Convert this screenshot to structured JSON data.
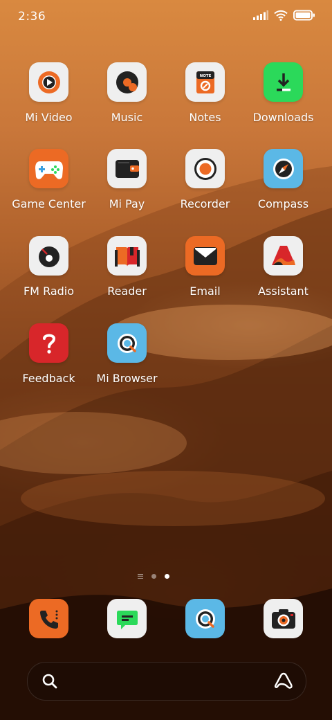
{
  "status_bar": {
    "time": "2:36",
    "icons": [
      "signal-icon",
      "wifi-icon",
      "battery-icon"
    ]
  },
  "apps": [
    {
      "label": "Mi Video",
      "icon": "mi-video-icon"
    },
    {
      "label": "Music",
      "icon": "music-icon"
    },
    {
      "label": "Notes",
      "icon": "notes-icon",
      "icon_text": "NOTE"
    },
    {
      "label": "Downloads",
      "icon": "downloads-icon"
    },
    {
      "label": "Game Center",
      "icon": "game-center-icon"
    },
    {
      "label": "Mi Pay",
      "icon": "mi-pay-icon"
    },
    {
      "label": "Recorder",
      "icon": "recorder-icon"
    },
    {
      "label": "Compass",
      "icon": "compass-icon"
    },
    {
      "label": "FM Radio",
      "icon": "fm-radio-icon"
    },
    {
      "label": "Reader",
      "icon": "reader-icon"
    },
    {
      "label": "Email",
      "icon": "email-icon"
    },
    {
      "label": "Assistant",
      "icon": "assistant-icon"
    },
    {
      "label": "Feedback",
      "icon": "feedback-icon"
    },
    {
      "label": "Mi Browser",
      "icon": "mi-browser-icon"
    }
  ],
  "page_indicator": {
    "pages": 2,
    "current": 2
  },
  "dock": [
    {
      "icon": "phone-icon"
    },
    {
      "icon": "messages-icon"
    },
    {
      "icon": "browser-icon"
    },
    {
      "icon": "camera-icon"
    }
  ],
  "search_bar": {
    "icons": [
      "search-icon",
      "assistant-icon"
    ]
  },
  "colors": {
    "orange": "#ec6a24",
    "light_tile": "#efefef",
    "green": "#2bd95a",
    "blue": "#5bb8e6",
    "red": "#d8262a"
  }
}
